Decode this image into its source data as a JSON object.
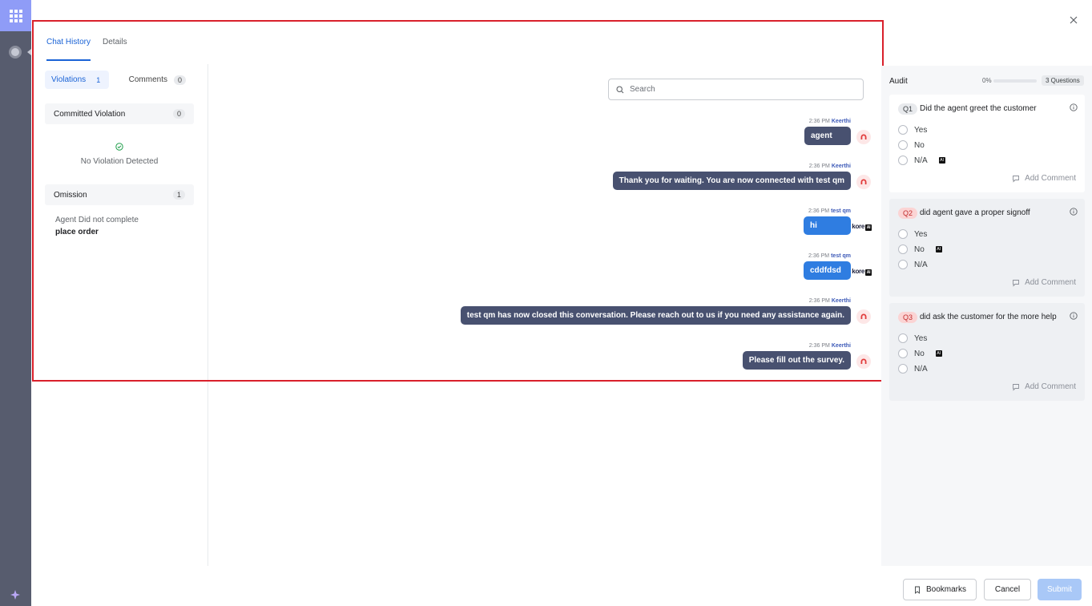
{
  "tabs": {
    "chat_history": "Chat History",
    "details": "Details"
  },
  "left": {
    "violations_label": "Violations",
    "violations_count": "1",
    "comments_label": "Comments",
    "comments_count": "0",
    "committed_label": "Committed Violation",
    "committed_count": "0",
    "no_violation": "No Violation Detected",
    "omission_label": "Omission",
    "omission_count": "1",
    "omission_note": "Agent Did not complete",
    "omission_item": "place order"
  },
  "search": {
    "placeholder": "Search"
  },
  "messages": [
    {
      "time": "2:36 PM",
      "sender": "Keerthi",
      "text": "agent"
    },
    {
      "time": "2:36 PM",
      "sender": "Keerthi",
      "text": "Thank you for waiting. You are now connected with test qm"
    },
    {
      "time": "2:36 PM",
      "sender": "test qm",
      "text": "hi"
    },
    {
      "time": "2:36 PM",
      "sender": "test qm",
      "text": "cddfdsd"
    },
    {
      "time": "2:36 PM",
      "sender": "Keerthi",
      "text": "test qm has now closed this conversation. Please reach out to us if you need any assistance again."
    },
    {
      "time": "2:36 PM",
      "sender": "Keerthi",
      "text": "Please fill out the survey."
    }
  ],
  "kore_label": "kore",
  "ai_mark": "AI",
  "audit": {
    "title": "Audit",
    "progress_text": "0%",
    "progress": 0,
    "questions_count": "3 Questions",
    "questions": [
      {
        "num": "Q1",
        "text": "Did the agent greet the customer",
        "options": [
          "Yes",
          "No",
          "N/A"
        ],
        "add_comment": "Add Comment"
      },
      {
        "num": "Q2",
        "text": "did agent gave a proper signoff",
        "options": [
          "Yes",
          "No",
          "N/A"
        ],
        "add_comment": "Add Comment"
      },
      {
        "num": "Q3",
        "text": "did ask the customer for the more help",
        "options": [
          "Yes",
          "No",
          "N/A"
        ],
        "add_comment": "Add Comment"
      }
    ]
  },
  "footer": {
    "bookmarks": "Bookmarks",
    "cancel": "Cancel",
    "submit": "Submit"
  },
  "colors": {
    "accent": "#1a63d6",
    "agent_bubble": "#485170",
    "user_bubble": "#2f7de1",
    "highlight": "#d9202b"
  }
}
